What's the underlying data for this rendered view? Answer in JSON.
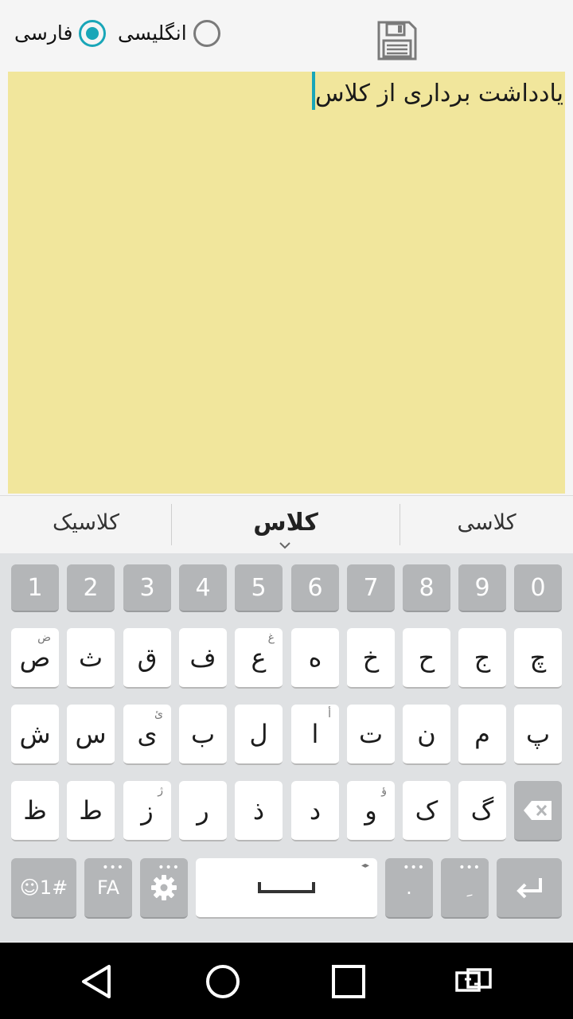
{
  "language": {
    "farsi_label": "فارسی",
    "english_label": "انگلیسی",
    "selected": "farsi"
  },
  "note": {
    "text": "یادداشت برداری از کلاس",
    "background": "#f1e69c"
  },
  "suggestions": {
    "left": "کلاسیک",
    "center": "کلاس",
    "right": "کلاسی"
  },
  "keyboard": {
    "numbers": [
      "1",
      "2",
      "3",
      "4",
      "5",
      "6",
      "7",
      "8",
      "9",
      "0"
    ],
    "row1": [
      "ص",
      "ث",
      "ق",
      "ف",
      "ع",
      "ه",
      "خ",
      "ح",
      "ج",
      "چ"
    ],
    "row1_alt": [
      "ض",
      "",
      "",
      "",
      "غ",
      "",
      "",
      "",
      "",
      ""
    ],
    "row2": [
      "ش",
      "س",
      "ی",
      "ب",
      "ل",
      "ا",
      "ت",
      "ن",
      "م",
      "پ"
    ],
    "row2_alt": [
      "",
      "",
      "ئ",
      "",
      "",
      "أ",
      "",
      "",
      "",
      ""
    ],
    "row3": [
      "ظ",
      "ط",
      "ز",
      "ر",
      "ذ",
      "د",
      "و",
      "ک",
      "گ"
    ],
    "row3_alt": [
      "",
      "",
      "ژ",
      "",
      "",
      "",
      "ؤ",
      "",
      "",
      ""
    ],
    "symbols_label": "☺1#",
    "lang_label": "FA",
    "period_label": ".",
    "comma_label": "ِ",
    "more_dots": "•••"
  },
  "colors": {
    "accent": "#19a6b8",
    "key_gray": "#b4b6b8"
  }
}
